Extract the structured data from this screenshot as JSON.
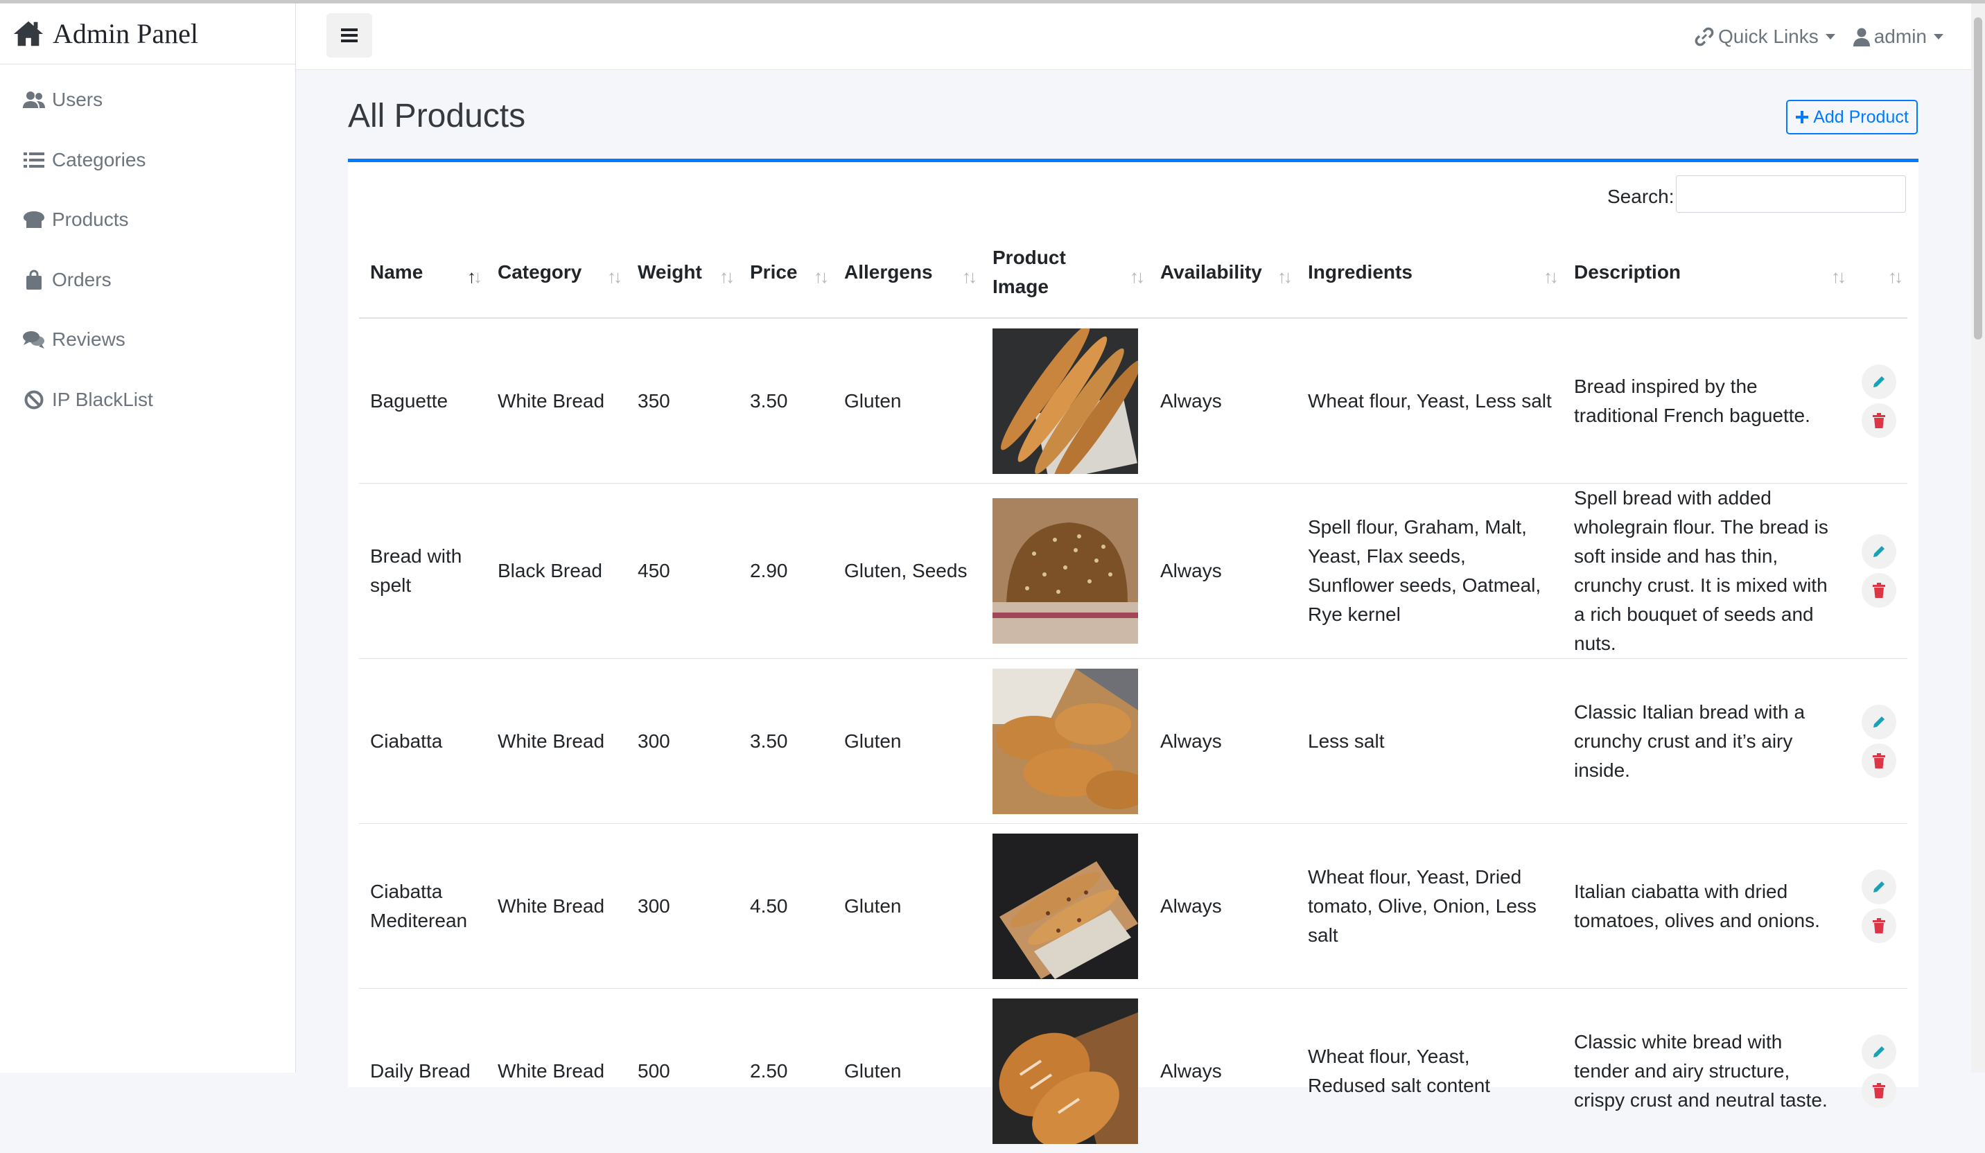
{
  "app": {
    "brand": "Admin Panel"
  },
  "sidebar": {
    "items": [
      {
        "label": "Users",
        "icon": "users-icon"
      },
      {
        "label": "Categories",
        "icon": "list-icon"
      },
      {
        "label": "Products",
        "icon": "bread-icon"
      },
      {
        "label": "Orders",
        "icon": "shopping-bag-icon"
      },
      {
        "label": "Reviews",
        "icon": "comments-icon"
      },
      {
        "label": "IP BlackList",
        "icon": "ban-icon"
      }
    ]
  },
  "navbar": {
    "quick_links": "Quick Links",
    "user": "admin"
  },
  "main": {
    "title": "All Products",
    "add_button": "Add Product",
    "search_label": "Search:",
    "search_value": ""
  },
  "table": {
    "columns": [
      "Name",
      "Category",
      "Weight",
      "Price",
      "Allergens",
      "Product Image",
      "Availability",
      "Ingredients",
      "Description"
    ],
    "rows": [
      {
        "name": "Baguette",
        "category": "White Bread",
        "weight": "350",
        "price": "3.50",
        "allergens": "Gluten",
        "availability": "Always",
        "ingredients": "Wheat flour, Yeast, Less salt",
        "description": "Bread inspired by the traditional French baguette."
      },
      {
        "name": "Bread with spelt",
        "category": "Black Bread",
        "weight": "450",
        "price": "2.90",
        "allergens": "Gluten, Seeds",
        "availability": "Always",
        "ingredients": "Spell flour, Graham, Malt, Yeast, Flax seeds, Sunflower seeds, Oatmeal, Rye kernel",
        "description": "Spell bread with added wholegrain flour. The bread is soft inside and has thin, crunchy crust. It is mixed with a rich bouquet of seeds and nuts."
      },
      {
        "name": "Ciabatta",
        "category": "White Bread",
        "weight": "300",
        "price": "3.50",
        "allergens": "Gluten",
        "availability": "Always",
        "ingredients": "Less salt",
        "description": "Classic Italian bread with a crunchy crust and it’s airy inside."
      },
      {
        "name": "Ciabatta Mediterean",
        "category": "White Bread",
        "weight": "300",
        "price": "4.50",
        "allergens": "Gluten",
        "availability": "Always",
        "ingredients": "Wheat flour, Yeast, Dried tomato, Olive, Onion, Less salt",
        "description": "Italian ciabatta with dried tomatoes, olives and onions."
      },
      {
        "name": "Daily Bread",
        "category": "White Bread",
        "weight": "500",
        "price": "2.50",
        "allergens": "Gluten",
        "availability": "Always",
        "ingredients": "Wheat flour, Yeast, Redused salt content",
        "description": "Classic white bread with tender and airy structure, crispy crust and neutral taste."
      }
    ]
  },
  "colors": {
    "primary": "#007bff",
    "edit": "#17a2b8",
    "delete": "#dc3545"
  }
}
